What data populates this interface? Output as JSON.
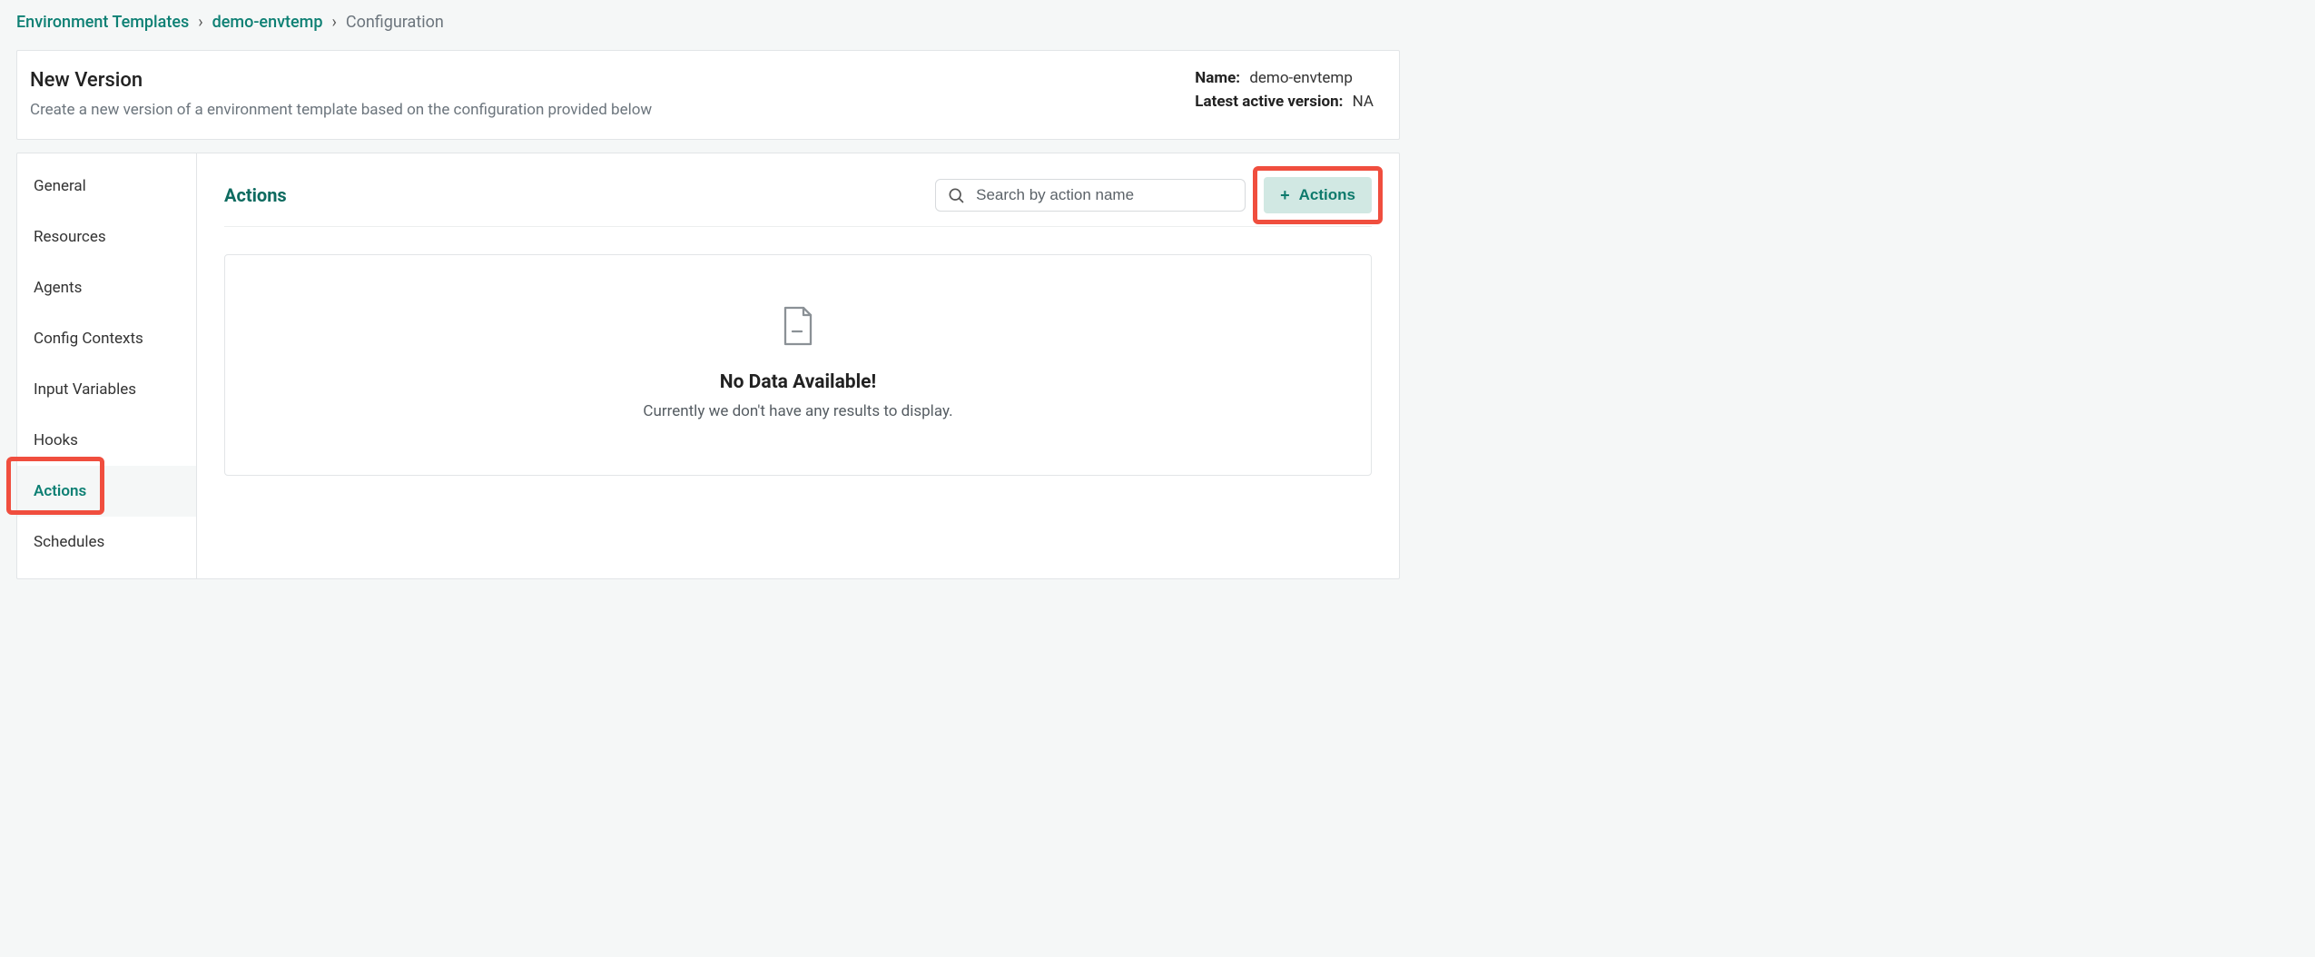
{
  "breadcrumb": {
    "root": "Environment Templates",
    "parent": "demo-envtemp",
    "current": "Configuration"
  },
  "header": {
    "title": "New Version",
    "subtitle": "Create a new version of a environment template based on the configuration provided below",
    "name_label": "Name:",
    "name_value": "demo-envtemp",
    "version_label": "Latest active version:",
    "version_value": "NA"
  },
  "sidebar": {
    "items": [
      {
        "label": "General"
      },
      {
        "label": "Resources"
      },
      {
        "label": "Agents"
      },
      {
        "label": "Config Contexts"
      },
      {
        "label": "Input Variables"
      },
      {
        "label": "Hooks"
      },
      {
        "label": "Actions"
      },
      {
        "label": "Schedules"
      }
    ]
  },
  "main": {
    "title": "Actions",
    "search_placeholder": "Search by action name",
    "add_button_label": "Actions",
    "empty_title": "No Data Available!",
    "empty_subtitle": "Currently we don't have any results to display."
  }
}
